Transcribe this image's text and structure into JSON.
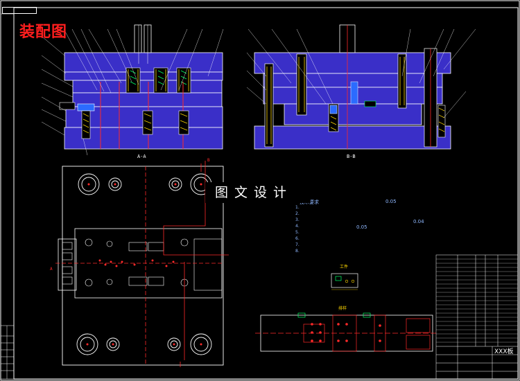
{
  "drawing": {
    "title": "装配图",
    "watermark": "图文设计",
    "corner_tag": "",
    "section_aa": "A-A",
    "section_bb": "B-B",
    "view_label_a": "A",
    "view_label_b": "B",
    "title_block_code": "XXX板",
    "notes": [
      "技术要求",
      "1.",
      "2.",
      "3.",
      "4.",
      "5.",
      "6.",
      "7.",
      "8."
    ],
    "note_values": [
      "0.05",
      "0.04",
      "0.05"
    ],
    "part_view_labels": [
      "工件",
      "排样"
    ]
  },
  "colors": {
    "background": "#000000",
    "outline": "#ffffff",
    "plate_fill": "#3a2fc8",
    "part_red": "#ff2a2a",
    "accent_green": "#00ff66",
    "accent_yellow": "#ffd800",
    "accent_cyan": "#00ffff"
  }
}
